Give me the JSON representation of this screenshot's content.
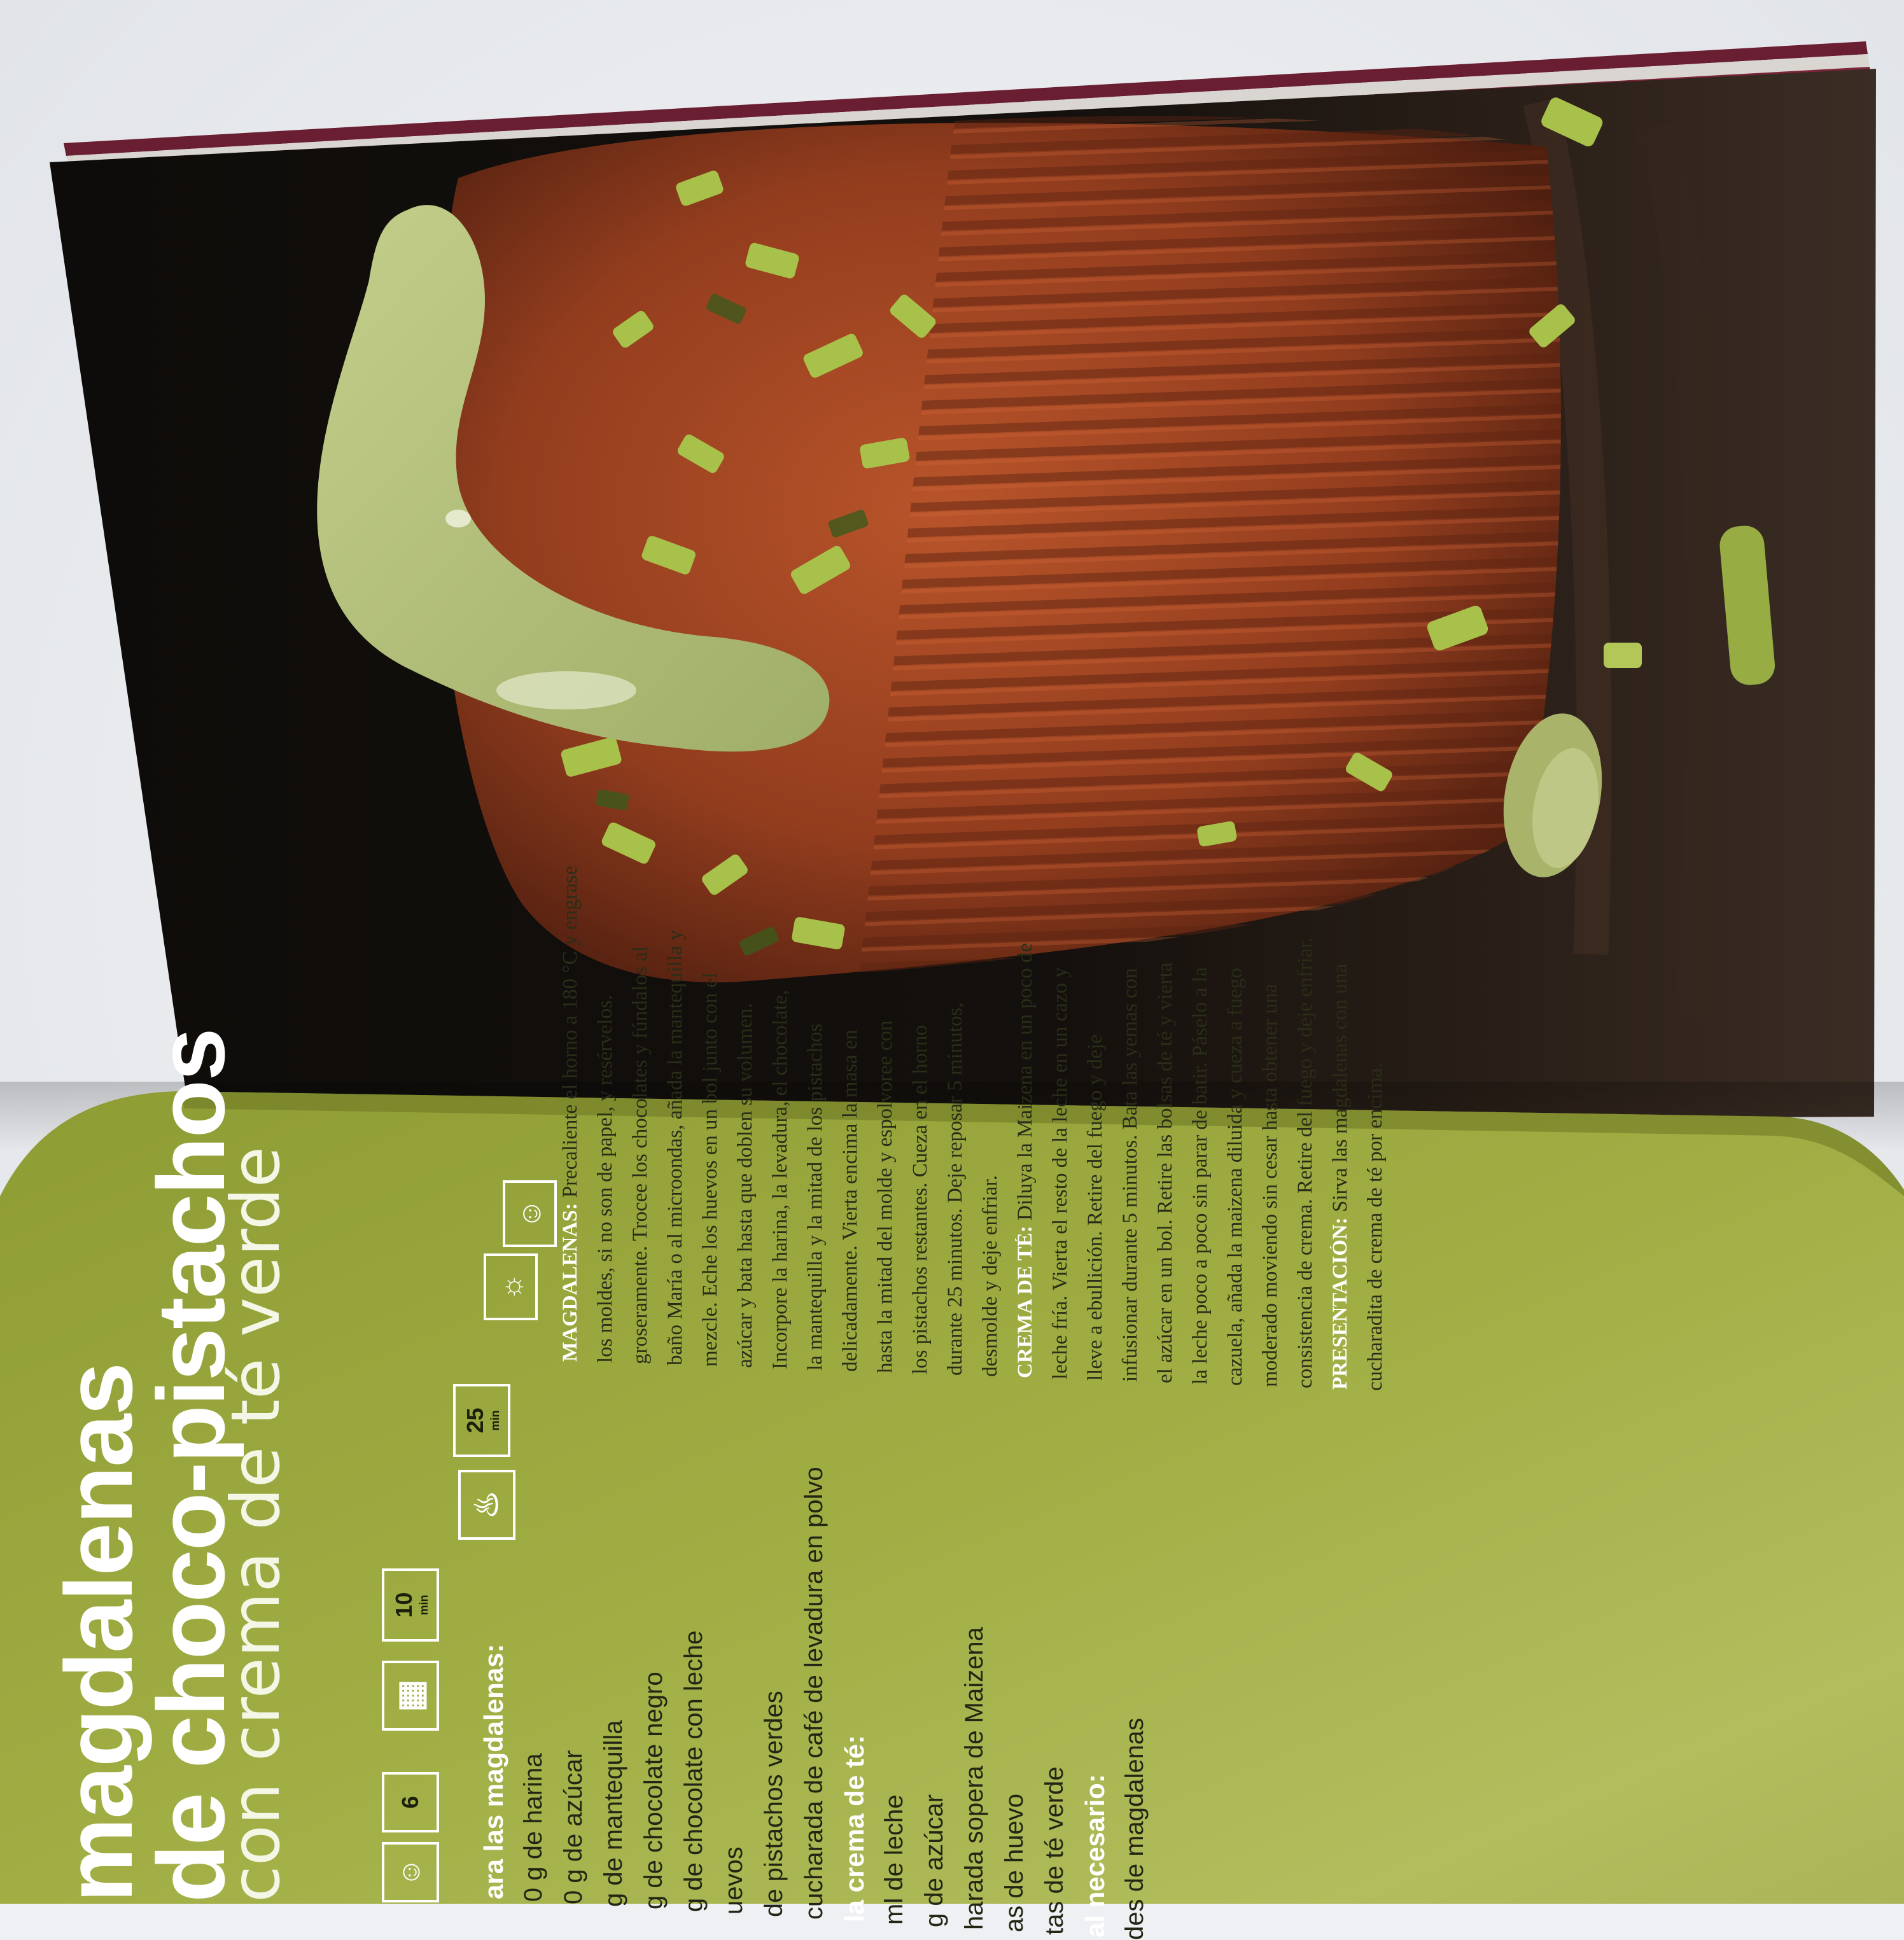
{
  "recipe": {
    "title_line1": "magdalenas",
    "title_line2": "de choco-pistachos",
    "subtitle": "con crema de té verde",
    "info": {
      "servings": "6",
      "prep_time": "10",
      "prep_unit": "min",
      "cook_time": "25",
      "cook_unit": "min"
    },
    "ingredients_head_1": "ara las magdalenas:",
    "ingredients_1": [
      "0 g de harina",
      "0 g de azúcar",
      "g de mantequilla",
      "g de chocolate negro",
      "g de chocolate con leche",
      "uevos",
      "de pistachos verdes",
      "cucharada de café de levadura en polvo"
    ],
    "ingredients_head_2": "la crema de té:",
    "ingredients_2": [
      "ml de leche",
      "g de azúcar",
      "harada sopera de Maizena",
      "as de huevo",
      "tas de té verde"
    ],
    "ingredients_head_3": "al necesario:",
    "ingredients_3": [
      "des de magdalenas"
    ],
    "method_lines": [
      {
        "head": "MAGDALENAS:",
        "text": " Precaliente el horno a 180 °C y engrase"
      },
      {
        "head": "",
        "text": "los moldes, si no son de papel, y resérvelos."
      },
      {
        "head": "",
        "text": "groseramente. Trocee los chocolates y fúndalos al"
      },
      {
        "head": "",
        "text": "baño María o al microondas, añada la mantequilla y"
      },
      {
        "head": "",
        "text": "mezcle. Eche los huevos en un bol junto con el"
      },
      {
        "head": "",
        "text": "azúcar y bata hasta que doblen su volumen."
      },
      {
        "head": "",
        "text": "Incorpore la harina, la levadura, el chocolate,"
      },
      {
        "head": "",
        "text": "la mantequilla y la mitad de los pistachos"
      },
      {
        "head": "",
        "text": "delicadamente. Vierta encima la masa en"
      },
      {
        "head": "",
        "text": "hasta la mitad del molde y espolvoree con"
      },
      {
        "head": "",
        "text": "los pistachos restantes. Cueza en el horno"
      },
      {
        "head": "",
        "text": "durante 25 minutos. Deje reposar 5 minutos,"
      },
      {
        "head": "",
        "text": "desmolde y deje enfriar."
      },
      {
        "head": "CREMA DE TÉ:",
        "text": " Diluya la Maizena en un poco de"
      },
      {
        "head": "",
        "text": "leche fría. Vierta el resto de la leche en un cazo y"
      },
      {
        "head": "",
        "text": "lleve a ebullición. Retire del fuego y deje"
      },
      {
        "head": "",
        "text": "infusionar durante 5 minutos. Bata las yemas con"
      },
      {
        "head": "",
        "text": "el azúcar en un bol. Retire las bolsas de té y vierta"
      },
      {
        "head": "",
        "text": "la leche poco a poco sin parar de batir. Páselo a la"
      },
      {
        "head": "",
        "text": "cazuela, añada la maizena diluida y cueza a fuego"
      },
      {
        "head": "",
        "text": "moderado moviendo sin cesar hasta obtener una"
      },
      {
        "head": "",
        "text": "consistencia de crema. Retire del fuego y deje enfriar."
      },
      {
        "head": "PRESENTACIÓN:",
        "text": " Sirva las magdalenas con una"
      },
      {
        "head": "",
        "text": "cucharadita de crema de té por encima."
      }
    ]
  },
  "colors": {
    "page_green": "#9aa83e",
    "photo_dark": "#1c1713",
    "cake_brown": "#8a3a1e",
    "pistachio": "#a9c24c",
    "cream": "#b6c17a"
  }
}
